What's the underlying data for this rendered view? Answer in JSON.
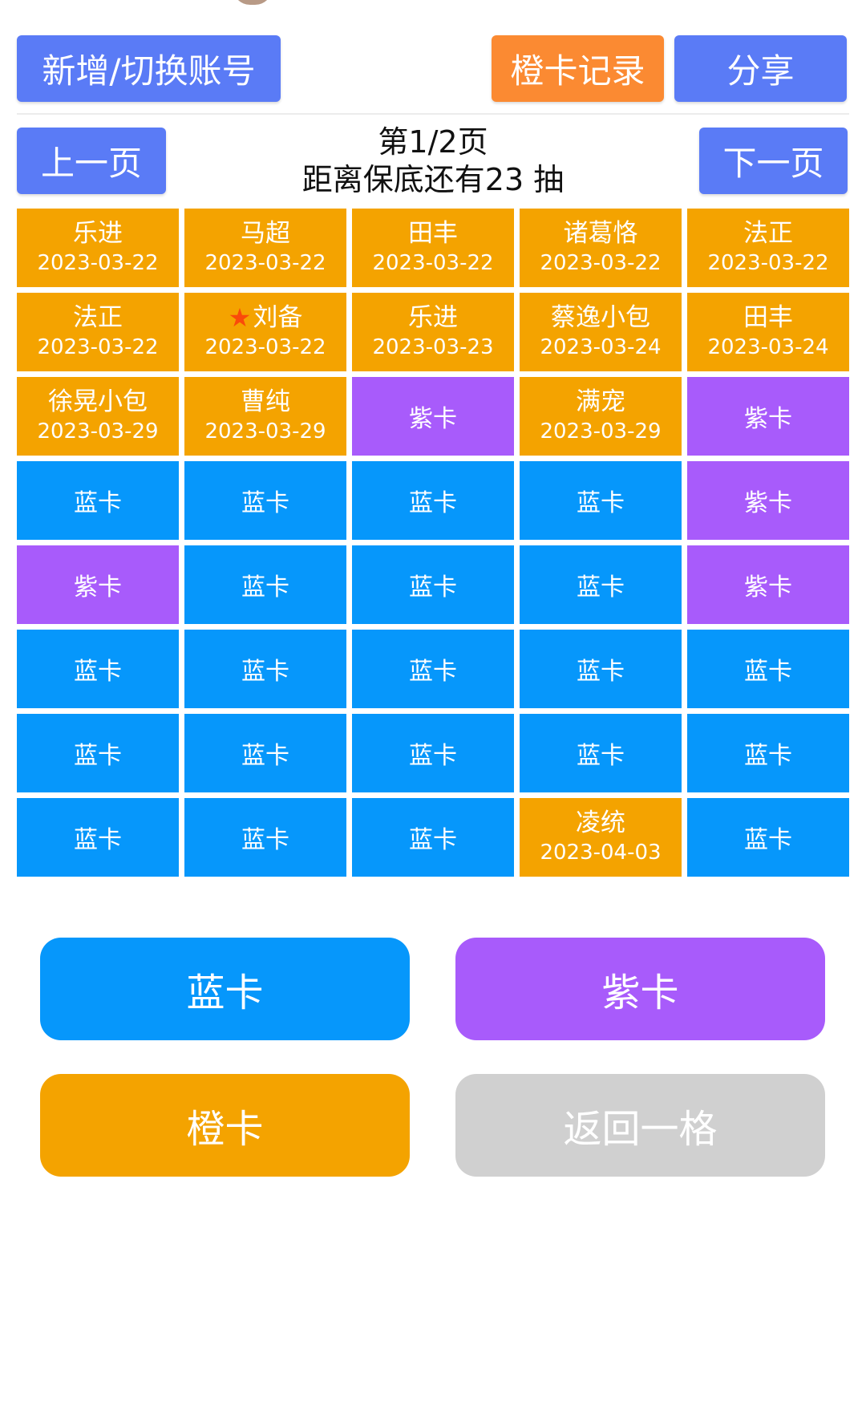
{
  "header": {
    "add_switch_account": "新增/切换账号",
    "orange_record": "橙卡记录",
    "share": "分享"
  },
  "pager": {
    "prev": "上一页",
    "next": "下一页",
    "page_label": "第1/2页",
    "pity_label": "距离保底还有23 抽"
  },
  "colors": {
    "blue": "#0697fb",
    "purple": "#a85bfb",
    "orange": "#f4a300",
    "gray": "#d0d0d0",
    "top_blue": "#5a7bf6",
    "top_orange": "#fb8a32"
  },
  "cards": [
    {
      "type": "orange",
      "name": "乐进",
      "date": "2023-03-22"
    },
    {
      "type": "orange",
      "name": "马超",
      "date": "2023-03-22"
    },
    {
      "type": "orange",
      "name": "田丰",
      "date": "2023-03-22"
    },
    {
      "type": "orange",
      "name": "诸葛恪",
      "date": "2023-03-22"
    },
    {
      "type": "orange",
      "name": "法正",
      "date": "2023-03-22"
    },
    {
      "type": "orange",
      "name": "法正",
      "date": "2023-03-22"
    },
    {
      "type": "orange",
      "name": "刘备",
      "date": "2023-03-22",
      "star": true
    },
    {
      "type": "orange",
      "name": "乐进",
      "date": "2023-03-23"
    },
    {
      "type": "orange",
      "name": "蔡逸小包",
      "date": "2023-03-24"
    },
    {
      "type": "orange",
      "name": "田丰",
      "date": "2023-03-24"
    },
    {
      "type": "orange",
      "name": "徐晃小包",
      "date": "2023-03-29"
    },
    {
      "type": "orange",
      "name": "曹纯",
      "date": "2023-03-29"
    },
    {
      "type": "purple",
      "label": "紫卡"
    },
    {
      "type": "orange",
      "name": "满宠",
      "date": "2023-03-29"
    },
    {
      "type": "purple",
      "label": "紫卡"
    },
    {
      "type": "blue",
      "label": "蓝卡"
    },
    {
      "type": "blue",
      "label": "蓝卡"
    },
    {
      "type": "blue",
      "label": "蓝卡"
    },
    {
      "type": "blue",
      "label": "蓝卡"
    },
    {
      "type": "purple",
      "label": "紫卡"
    },
    {
      "type": "purple",
      "label": "紫卡"
    },
    {
      "type": "blue",
      "label": "蓝卡"
    },
    {
      "type": "blue",
      "label": "蓝卡"
    },
    {
      "type": "blue",
      "label": "蓝卡"
    },
    {
      "type": "purple",
      "label": "紫卡"
    },
    {
      "type": "blue",
      "label": "蓝卡"
    },
    {
      "type": "blue",
      "label": "蓝卡"
    },
    {
      "type": "blue",
      "label": "蓝卡"
    },
    {
      "type": "blue",
      "label": "蓝卡"
    },
    {
      "type": "blue",
      "label": "蓝卡"
    },
    {
      "type": "blue",
      "label": "蓝卡"
    },
    {
      "type": "blue",
      "label": "蓝卡"
    },
    {
      "type": "blue",
      "label": "蓝卡"
    },
    {
      "type": "blue",
      "label": "蓝卡"
    },
    {
      "type": "blue",
      "label": "蓝卡"
    },
    {
      "type": "blue",
      "label": "蓝卡"
    },
    {
      "type": "blue",
      "label": "蓝卡"
    },
    {
      "type": "blue",
      "label": "蓝卡"
    },
    {
      "type": "orange",
      "name": "凌统",
      "date": "2023-04-03"
    },
    {
      "type": "blue",
      "label": "蓝卡"
    }
  ],
  "actions": {
    "blue": "蓝卡",
    "purple": "紫卡",
    "orange": "橙卡",
    "undo": "返回一格"
  }
}
